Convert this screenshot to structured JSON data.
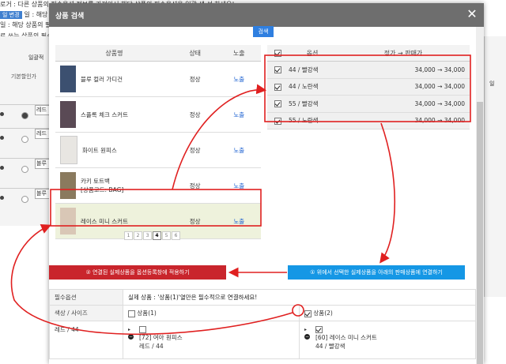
{
  "background": {
    "line1": "로거 : 다른 상품의 필수옵션 정보를 가져와서 해당 상품의 필수옵션을 일괄 생 성 하세요!",
    "badge": "일 변경",
    "line2": "일 : 해당 상품의 필수옵션",
    "line3": "일 : 해당 상품의 필수옵션",
    "line4": "로 쓰는 상품의 필수옵션",
    "tab_label": "일괄적",
    "col_header": "기본할인가",
    "row_labels": [
      "레드",
      "레드",
      "블루",
      "블루"
    ],
    "right_text": "일"
  },
  "modal": {
    "title": "상품 검색",
    "close_glyph": "✕",
    "search_label": "검색"
  },
  "products": {
    "headers": {
      "name": "상품명",
      "status": "상태",
      "expose": "노출"
    },
    "rows": [
      {
        "name": "블루 컬러 가디건",
        "code": "",
        "status": "정상",
        "expose": "노출",
        "selected": false
      },
      {
        "name": "스플록 체크 스커트",
        "code": "",
        "status": "정상",
        "expose": "노출",
        "selected": false
      },
      {
        "name": "화이트 원피스",
        "code": "",
        "status": "정상",
        "expose": "노출",
        "selected": false
      },
      {
        "name": "카키 토트백",
        "code": "[상품코드: BAG]",
        "status": "정상",
        "expose": "노출",
        "selected": false
      },
      {
        "name": "레이스 미니 스커트",
        "code": "",
        "status": "정상",
        "expose": "노출",
        "selected": true
      }
    ]
  },
  "pagination": {
    "pages": [
      "1",
      "2",
      "3",
      "4",
      "5",
      "6"
    ],
    "current": "4"
  },
  "options": {
    "headers": {
      "option": "옵션",
      "price": "정가 → 판매가"
    },
    "rows": [
      {
        "label": "44 / 빨강색",
        "price": "34,000 → 34,000",
        "checked": true
      },
      {
        "label": "44 / 노란색",
        "price": "34,000 → 34,000",
        "checked": true
      },
      {
        "label": "55 / 빨강색",
        "price": "34,000 → 34,000",
        "checked": true
      },
      {
        "label": "55 / 노란색",
        "price": "34,000 → 34,000",
        "checked": true
      }
    ]
  },
  "actions": {
    "apply": "② 연결된 실제상품을 옵션등록창에 적용하기",
    "connect": "① 위에서 선택한 실제상품을 아래의 판매상품에 연결하기"
  },
  "required": {
    "label": "필수옵션",
    "text": "실제 상품 : '상품(1)'열만은 필수적으로 연결하세요!",
    "col_label": "색상 / 사이즈",
    "product1": "상품(1)",
    "product2": "상품(2)",
    "row_label": "레드 / 44",
    "item1_title": "[72] 여아 원피스",
    "item1_sub": "레드 / 44",
    "item2_title": "[60] 레이스 미니 스커트",
    "item2_sub": "44 / 빨강색"
  },
  "colors": {
    "header": "#6e6e6e",
    "accent_blue": "#2f7fe0",
    "btn_red": "#c9252c",
    "btn_blue": "#1597e5",
    "highlight": "#e02020",
    "selected_row": "#eef2dc"
  }
}
